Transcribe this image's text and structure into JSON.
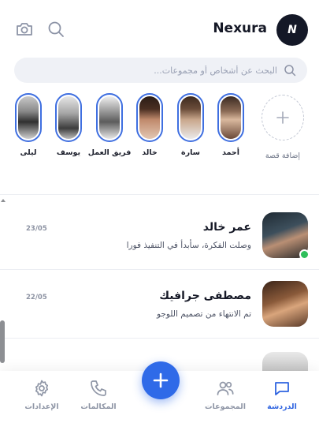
{
  "header": {
    "brand": "Nexura",
    "logo_letter": "N",
    "icons": [
      "camera-icon",
      "search-icon"
    ]
  },
  "search": {
    "placeholder": "البحث عن أشخاص أو مجموعات..."
  },
  "stories": {
    "add_label": "إضافة قصة",
    "items": [
      {
        "name": "أحمد"
      },
      {
        "name": "سارة"
      },
      {
        "name": "خالد"
      },
      {
        "name": "فريق العمل"
      },
      {
        "name": "يوسف"
      },
      {
        "name": "ليلى"
      }
    ]
  },
  "chats": [
    {
      "name": "عمر خالد",
      "message": "وصلت الفكرة، سأبدأ في التنفيذ فورا",
      "time": "23/05",
      "online": true
    },
    {
      "name": "مصطفى جرافيك",
      "message": "تم الانتهاء من تصميم اللوجو",
      "time": "22/05",
      "online": false
    }
  ],
  "nav": {
    "chats": "الدردشة",
    "groups": "المجموعات",
    "calls": "المكالمات",
    "settings": "الإعدادات"
  },
  "colors": {
    "accent": "#2f6ae8",
    "story_ring": "#3f6fe0",
    "online": "#2fbf5b"
  }
}
